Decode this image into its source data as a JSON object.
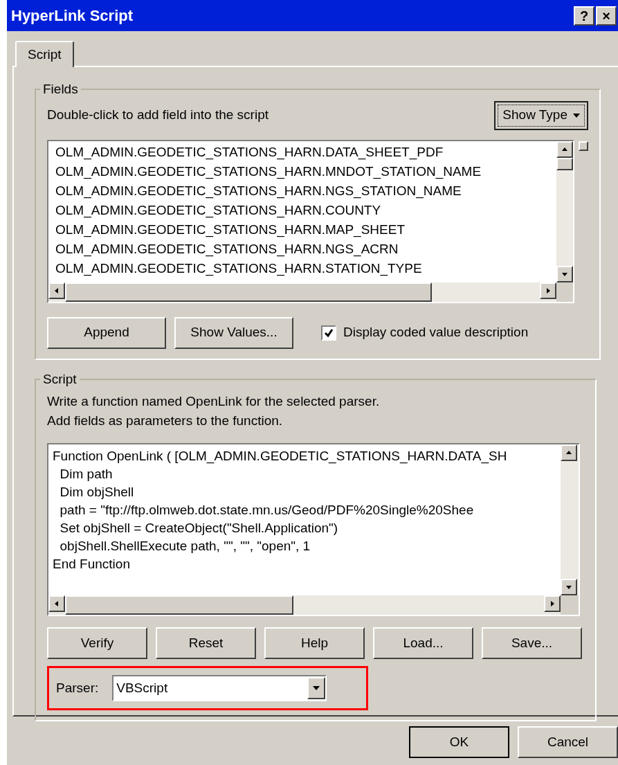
{
  "window": {
    "title": "HyperLink Script",
    "buttons": [
      "?",
      "×"
    ]
  },
  "tabs": [
    {
      "label": "Script",
      "selected": true
    }
  ],
  "fields_group": {
    "title": "Fields",
    "hint": "Double-click to add field into the script",
    "show_type_button": "Show Type",
    "items": [
      {
        "label": "OLM_ADMIN.GEODETIC_STATIONS_HARN.DATA_SHEET_PDF",
        "selected": false
      },
      {
        "label": "OLM_ADMIN.GEODETIC_STATIONS_HARN.MNDOT_STATION_NAME",
        "selected": false
      },
      {
        "label": "OLM_ADMIN.GEODETIC_STATIONS_HARN.NGS_STATION_NAME",
        "selected": false
      },
      {
        "label": "OLM_ADMIN.GEODETIC_STATIONS_HARN.COUNTY",
        "selected": false
      },
      {
        "label": "OLM_ADMIN.GEODETIC_STATIONS_HARN.MAP_SHEET",
        "selected": false
      },
      {
        "label": "OLM_ADMIN.GEODETIC_STATIONS_HARN.NGS_ACRN",
        "selected": false
      },
      {
        "label": "OLM_ADMIN.GEODETIC_STATIONS_HARN.STATION_TYPE",
        "selected": false
      }
    ],
    "buttons": [
      "Append",
      "Show Values..."
    ],
    "checkbox": {
      "label": "Display coded value description",
      "checked": true
    }
  },
  "script_group": {
    "title": "Script",
    "instructions": [
      "Write a function named OpenLink for the selected parser.",
      "Add fields as parameters to the function."
    ],
    "code_lines": [
      "Function OpenLink ( [OLM_ADMIN.GEODETIC_STATIONS_HARN.DATA_SH",
      "  Dim path",
      "  Dim objShell",
      "  path = \"ftp://ftp.olmweb.dot.state.mn.us/Geod/PDF%20Single%20Shee",
      "  Set objShell = CreateObject(\"Shell.Application\")",
      "  objShell.ShellExecute path, \"\", \"\", \"open\", 1",
      "End Function"
    ],
    "buttons": [
      "Verify",
      "Reset",
      "Help",
      "Load...",
      "Save..."
    ],
    "parser": {
      "label": "Parser:",
      "value": "VBScript",
      "highlighted": true
    }
  },
  "footer_buttons": [
    {
      "label": "OK",
      "default": true
    },
    {
      "label": "Cancel",
      "default": false
    }
  ]
}
